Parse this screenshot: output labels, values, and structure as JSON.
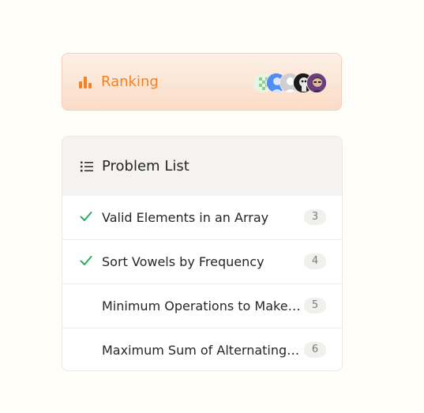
{
  "ranking": {
    "title": "Ranking",
    "icon": "bar-chart-icon",
    "accent_color": "#f7801f",
    "avatars": [
      "avatar-green-pattern",
      "avatar-blue-default",
      "avatar-gray-default",
      "avatar-dark-character",
      "avatar-photo"
    ]
  },
  "problem_list": {
    "title": "Problem List",
    "icon": "list-icon",
    "items": [
      {
        "title": "Valid Elements in an Array",
        "count": "3",
        "solved": true
      },
      {
        "title": "Sort Vowels by Frequency",
        "count": "4",
        "solved": true
      },
      {
        "title": "Minimum Operations to Make Array Elements Equal",
        "count": "5",
        "solved": false
      },
      {
        "title": "Maximum Sum of Alternating Subsequence",
        "count": "6",
        "solved": false
      }
    ],
    "check_color": "#1fb25a"
  }
}
